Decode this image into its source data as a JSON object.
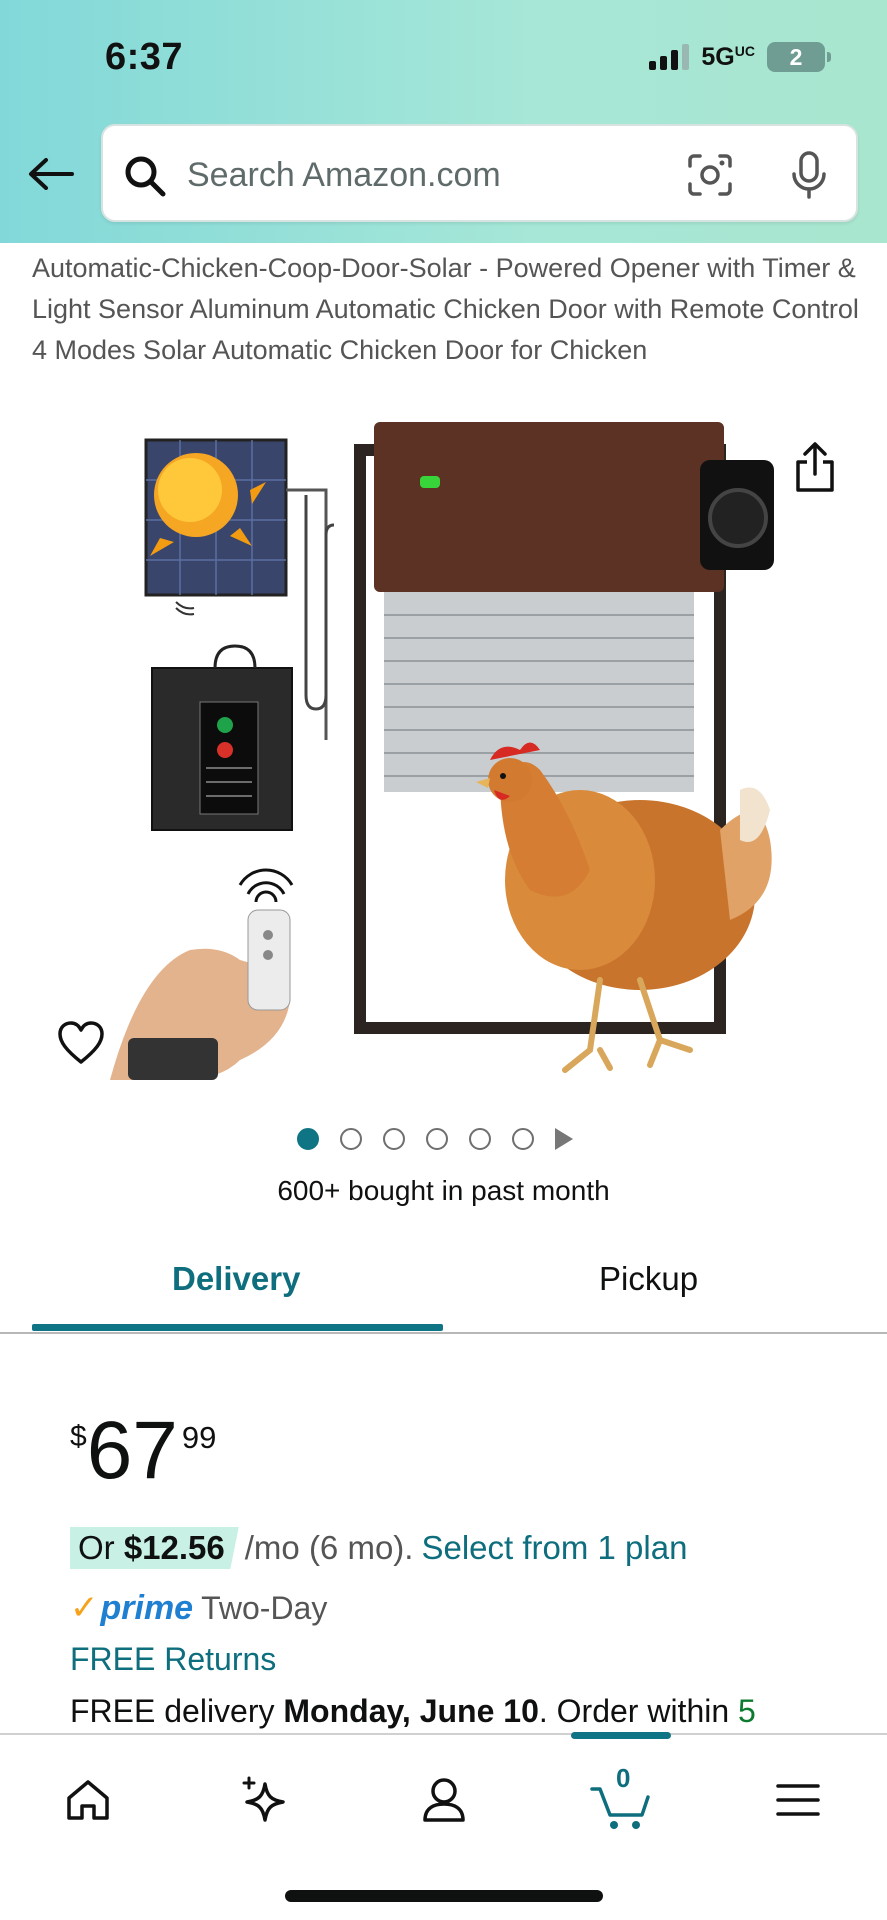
{
  "status_bar": {
    "time": "6:37",
    "network": "5G",
    "network_suffix": "UC",
    "battery": "2"
  },
  "search": {
    "placeholder": "Search Amazon.com"
  },
  "product": {
    "title": "Automatic-Chicken-Coop-Door-Solar - Powered Opener with Timer & Light Sensor Aluminum Automatic Chicken Door with Remote Control 4 Modes Solar Automatic Chicken Door for Chicken",
    "image_count": 6,
    "active_image": 1,
    "bought": "600+ bought in past month"
  },
  "tabs": [
    {
      "label": "Delivery",
      "active": true
    },
    {
      "label": "Pickup",
      "active": false
    }
  ],
  "price": {
    "symbol": "$",
    "whole": "67",
    "fraction": "99"
  },
  "monthly": {
    "prefix": "Or ",
    "amount": "$12.56",
    "rest": "/mo (6 mo).",
    "link": "Select from 1 plan"
  },
  "prime": {
    "check": "✓",
    "word": "prime",
    "label": "Two-Day"
  },
  "returns": "FREE Returns",
  "delivery": {
    "prefix": "FREE delivery ",
    "date": "Monday, June 10",
    "middle": ". Order within ",
    "countdown": "5"
  },
  "bottom_nav": {
    "cart_count": "0",
    "items": [
      "home-icon",
      "sparkle-icon",
      "account-icon",
      "cart-icon",
      "menu-icon"
    ]
  },
  "colors": {
    "accent": "#0f7584",
    "prime_blue": "#1f7fd1",
    "prime_orange": "#f6a31b",
    "countdown_green": "#0c7a2f"
  }
}
